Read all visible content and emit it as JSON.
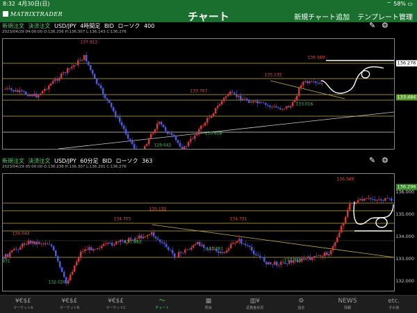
{
  "status": {
    "time": "8:32",
    "date": "4月30日(日)",
    "battery": "58%"
  },
  "header": {
    "logo": "MATRIXTRADER",
    "title": "チャート",
    "add_chart": "新規チャート追加",
    "templates": "テンプレート管理"
  },
  "chart1": {
    "new_order": "新規注文",
    "settle_order": "決済注文",
    "pair": "USD/JPY",
    "timeframe": "4時間足",
    "side": "BID",
    "chart_type": "ローソク",
    "count": "400",
    "ohlc": "2023/04/29 04:00:00  O:136.256  H:136.307  L:136.143  C:136.276",
    "current_price": "136.276",
    "target_price": "133.484",
    "y_ticks": [],
    "annotations": [
      "137.912",
      "136.560",
      "135.132",
      "133.767",
      "133.016",
      "130.618",
      "129.642"
    ],
    "line_color": "#c9b24a"
  },
  "chart2": {
    "new_order": "新規注文",
    "settle_order": "決済注文",
    "pair": "USD/JPY",
    "timeframe": "60分足",
    "side": "BID",
    "chart_type": "ローソク",
    "count": "363",
    "ohlc": "2023/04/29 05:00:00  O:136.238  H:136.307  L:136.201  C:136.276",
    "current_price": "136.296",
    "y_ticks": [
      "136.000",
      "135.000",
      "134.000",
      "133.000",
      "132.000"
    ],
    "annotations": [
      "136.560",
      "135.132",
      "134.705",
      "134.731",
      "134.044",
      "133.882",
      "133.651",
      "133.016",
      "132.020",
      "971"
    ]
  },
  "nav": {
    "items": [
      {
        "icon": "¥€$£",
        "label": "マーケットA"
      },
      {
        "icon": "¥€$£",
        "label": "マーケットB"
      },
      {
        "icon": "¥€$£",
        "label": "マーケットC"
      },
      {
        "icon": "〜",
        "label": "チャート"
      },
      {
        "icon": "▦",
        "label": "照会"
      },
      {
        "icon": "▥¥",
        "label": "証拠金状況"
      },
      {
        "icon": "⚙",
        "label": "設定"
      },
      {
        "icon": "NEWS",
        "label": "情報"
      },
      {
        "icon": "etc.",
        "label": "その他"
      }
    ]
  }
}
